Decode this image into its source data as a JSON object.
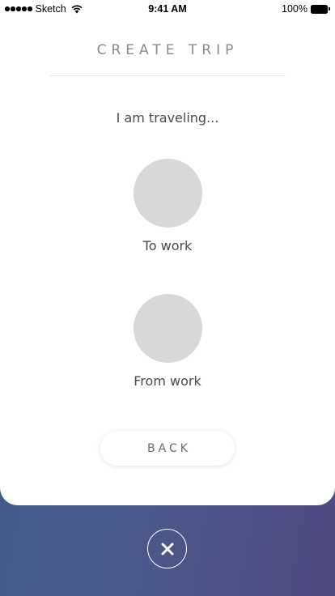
{
  "status_bar": {
    "carrier": "Sketch",
    "time": "9:41 AM",
    "battery": "100%"
  },
  "header": {
    "title": "CREATE TRIP"
  },
  "main": {
    "prompt": "I am traveling...",
    "options": [
      {
        "label": "To work"
      },
      {
        "label": "From work"
      }
    ],
    "back_label": "BACK"
  },
  "footer": {
    "close_icon": "close-icon"
  },
  "colors": {
    "placeholder_circle": "#d8d8d8",
    "text": "#4a4a4a",
    "title": "#8a8a8a",
    "background_gradient_start": "#3f5a8a",
    "background_gradient_end": "#4f4a80"
  }
}
